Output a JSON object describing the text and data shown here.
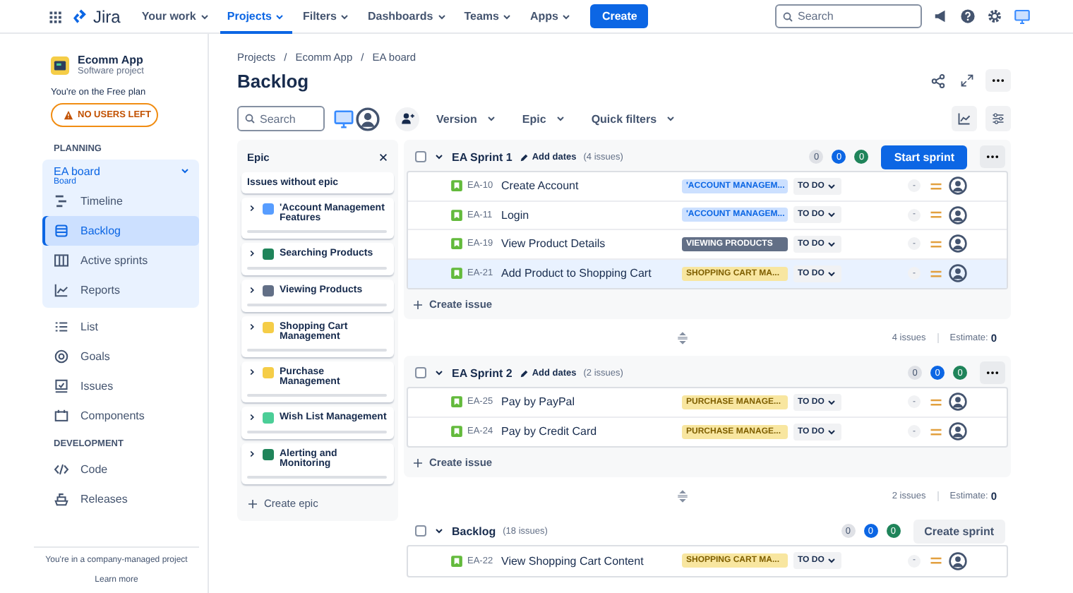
{
  "nav": {
    "logo": "Jira",
    "items": [
      {
        "label": "Your work",
        "selected": false
      },
      {
        "label": "Projects",
        "selected": true
      },
      {
        "label": "Filters",
        "selected": false
      },
      {
        "label": "Dashboards",
        "selected": false
      },
      {
        "label": "Teams",
        "selected": false
      },
      {
        "label": "Apps",
        "selected": false
      }
    ],
    "create": "Create",
    "search": {
      "placeholder": "Search"
    }
  },
  "sidebar": {
    "project": {
      "name": "Ecomm App",
      "type": "Software project"
    },
    "plan_note": "You're on the Free plan",
    "alert": "NO USERS LEFT",
    "planning": {
      "title": "PLANNING",
      "board": {
        "name": "EA board",
        "sub": "Board",
        "expanded": true
      },
      "items": [
        {
          "label": "Timeline",
          "kind": "timeline",
          "selected": false
        },
        {
          "label": "Backlog",
          "kind": "backlog",
          "selected": true
        },
        {
          "label": "Active sprints",
          "kind": "sprints",
          "selected": false
        },
        {
          "label": "Reports",
          "kind": "reports",
          "selected": false
        }
      ]
    },
    "items": [
      {
        "label": "List",
        "kind": "list",
        "selected": false
      },
      {
        "label": "Goals",
        "kind": "goals",
        "selected": false
      },
      {
        "label": "Issues",
        "kind": "issues",
        "selected": false
      },
      {
        "label": "Components",
        "kind": "components",
        "selected": false
      }
    ],
    "development": {
      "title": "DEVELOPMENT",
      "items": [
        {
          "label": "Code",
          "kind": "code",
          "selected": false
        },
        {
          "label": "Releases",
          "kind": "releases",
          "selected": false
        }
      ]
    },
    "footer": {
      "note": "You're in a company-managed project",
      "link": "Learn more"
    }
  },
  "breadcrumbs": {
    "separator": "/",
    "items": [
      "Projects",
      "Ecomm App",
      "EA board"
    ]
  },
  "title": "Backlog",
  "toolbar": {
    "search": {
      "placeholder": "Search"
    },
    "filters": [
      "Version",
      "Epic",
      "Quick filters"
    ]
  },
  "epic_panel": {
    "title": "Epic",
    "no_epic": "Issues without epic",
    "create": "Create epic",
    "epics": [
      {
        "name": "'Account Management Features",
        "color": "#579dff"
      },
      {
        "name": "Searching Products",
        "color": "#1f845a"
      },
      {
        "name": "Viewing Products",
        "color": "#626f86"
      },
      {
        "name": "Shopping Cart Management",
        "color": "#f5cd47"
      },
      {
        "name": "Purchase Management",
        "color": "#f5cd47"
      },
      {
        "name": "Wish List Management",
        "color": "#4bce97"
      },
      {
        "name": "Alerting and Monitoring",
        "color": "#1f845a"
      }
    ]
  },
  "sprints": [
    {
      "kind": "sprint",
      "checked": false,
      "name": "EA Sprint 1",
      "add_dates": "Add dates",
      "count": "(4 issues)",
      "counts": [
        {
          "value": "0",
          "color": "#dfe1e6"
        },
        {
          "value": "0",
          "color": "#0c66e4"
        },
        {
          "value": "0",
          "color": "#1f845a"
        }
      ],
      "action": {
        "label": "Start sprint",
        "kind": "primary"
      },
      "issues": [
        {
          "key": "EA-10",
          "summary": "Create Account",
          "epic": {
            "label": "'ACCOUNT MANAGEM...",
            "color": "#cce0ff"
          },
          "status": "TO DO",
          "estimate": "-",
          "selected": false
        },
        {
          "key": "EA-11",
          "summary": "Login",
          "epic": {
            "label": "'ACCOUNT MANAGEM...",
            "color": "#cce0ff"
          },
          "status": "TO DO",
          "estimate": "-",
          "selected": false
        },
        {
          "key": "EA-19",
          "summary": "View Product Details",
          "epic": {
            "label": "VIEWING PRODUCTS",
            "color": "#626f86"
          },
          "status": "TO DO",
          "estimate": "-",
          "selected": false
        },
        {
          "key": "EA-21",
          "summary": "Add Product to Shopping Cart",
          "epic": {
            "label": "SHOPPING CART MA...",
            "color": "#f8e6a0"
          },
          "status": "TO DO",
          "estimate": "-",
          "selected": true
        }
      ],
      "create_issue": "Create issue",
      "footer": {
        "issues": "4 issues",
        "estimate_label": "Estimate:",
        "estimate": "0"
      }
    },
    {
      "kind": "sprint",
      "checked": false,
      "name": "EA Sprint 2",
      "add_dates": "Add dates",
      "count": "(2 issues)",
      "counts": [
        {
          "value": "0",
          "color": "#dfe1e6"
        },
        {
          "value": "0",
          "color": "#0c66e4"
        },
        {
          "value": "0",
          "color": "#1f845a"
        }
      ],
      "action": {
        "kind": "more"
      },
      "issues": [
        {
          "key": "EA-25",
          "summary": "Pay by PayPal",
          "epic": {
            "label": "PURCHASE MANAGE...",
            "color": "#f8e6a0"
          },
          "status": "TO DO",
          "estimate": "-",
          "selected": false
        },
        {
          "key": "EA-24",
          "summary": "Pay by Credit Card",
          "epic": {
            "label": "PURCHASE MANAGE...",
            "color": "#f8e6a0"
          },
          "status": "TO DO",
          "estimate": "-",
          "selected": false
        }
      ],
      "create_issue": "Create issue",
      "footer": {
        "issues": "2 issues",
        "estimate_label": "Estimate:",
        "estimate": "0"
      }
    },
    {
      "kind": "backlog",
      "checked": false,
      "name": "Backlog",
      "count": "(18 issues)",
      "counts": [
        {
          "value": "0",
          "color": "#dfe1e6"
        },
        {
          "value": "0",
          "color": "#0c66e4"
        },
        {
          "value": "0",
          "color": "#1f845a"
        }
      ],
      "action": {
        "label": "Create sprint",
        "kind": "secondary"
      },
      "issues": [
        {
          "key": "EA-22",
          "summary": "View Shopping Cart Content",
          "epic": {
            "label": "SHOPPING CART MA...",
            "color": "#f8e6a0"
          },
          "status": "TO DO",
          "estimate": "-",
          "selected": false
        }
      ]
    }
  ]
}
